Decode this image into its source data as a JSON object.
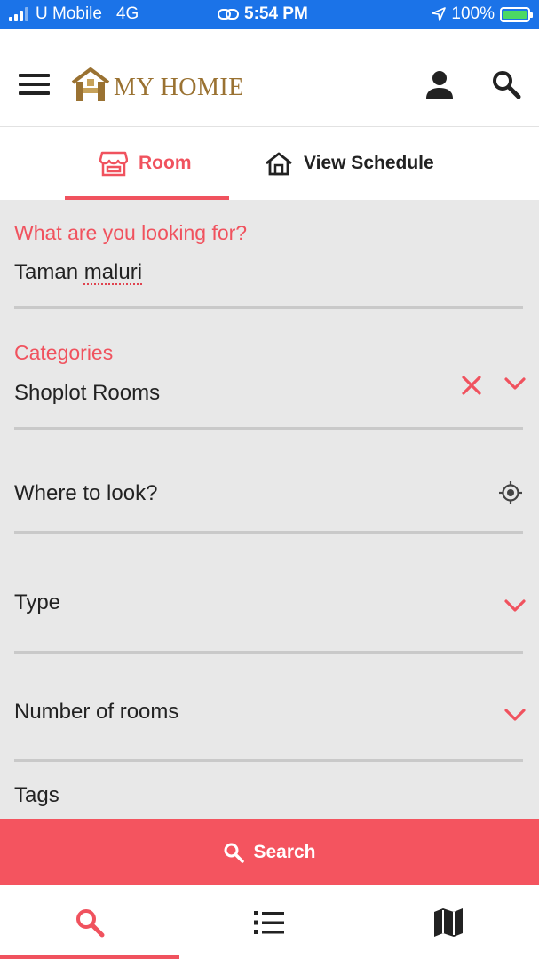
{
  "status_bar": {
    "carrier": "U Mobile",
    "network": "4G",
    "time": "5:54 PM",
    "battery": "100%"
  },
  "header": {
    "logo_text": "MY HOMIE",
    "menu_icon": "hamburger-menu-icon",
    "profile_icon": "user-icon",
    "search_icon": "search-icon"
  },
  "tabs": [
    {
      "label": "Room",
      "icon": "store-icon",
      "active": true
    },
    {
      "label": "View Schedule",
      "icon": "house-icon",
      "active": false
    }
  ],
  "form": {
    "keyword": {
      "label": "What are you looking for?",
      "value": "Taman maluri"
    },
    "categories": {
      "label": "Categories",
      "value": "Shoplot Rooms"
    },
    "location": {
      "placeholder": "Where to look?"
    },
    "type": {
      "placeholder": "Type"
    },
    "rooms": {
      "placeholder": "Number of rooms"
    },
    "tags": {
      "placeholder": "Tags"
    }
  },
  "search_button": {
    "label": "Search"
  },
  "bottom_nav": [
    {
      "icon": "search-icon",
      "active": true
    },
    {
      "icon": "list-icon",
      "active": false
    },
    {
      "icon": "map-icon",
      "active": false
    }
  ],
  "colors": {
    "accent": "#f0525e",
    "status_bar": "#1b73e8",
    "logo": "#9a7232",
    "form_background": "#e8e8e8"
  }
}
